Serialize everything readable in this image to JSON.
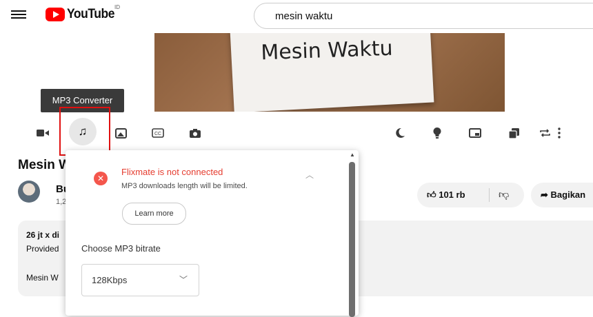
{
  "header": {
    "logo_text": "YouTube",
    "region_code": "ID",
    "search_value": "mesin waktu"
  },
  "video": {
    "thumbnail_text": "Mesin Waktu",
    "title": "Mesin W",
    "channel_name": "Bu",
    "channel_subs": "1,2",
    "likes": "101 rb",
    "share_label": "Bagikan"
  },
  "description": {
    "views": "26 jt x di",
    "provided": "Provided",
    "line3": "Mesin W"
  },
  "tooltip": "MP3 Converter",
  "toolbar": {
    "icons": [
      "camera-icon",
      "music-note-icon",
      "image-icon",
      "cc-icon",
      "screenshot-icon",
      "moon-icon",
      "lightbulb-icon",
      "pip-icon",
      "stack-icon",
      "repeat-icon",
      "more-icon"
    ]
  },
  "popup": {
    "error_title": "Flixmate is not connected",
    "error_subtitle": "MP3 downloads length will be limited.",
    "learn_more": "Learn more",
    "bitrate_label": "Choose MP3 bitrate",
    "bitrate_value": "128Kbps"
  },
  "colors": {
    "youtube_red": "#ff0000",
    "error_red": "#e53c2f",
    "highlight_red": "#e01010"
  }
}
